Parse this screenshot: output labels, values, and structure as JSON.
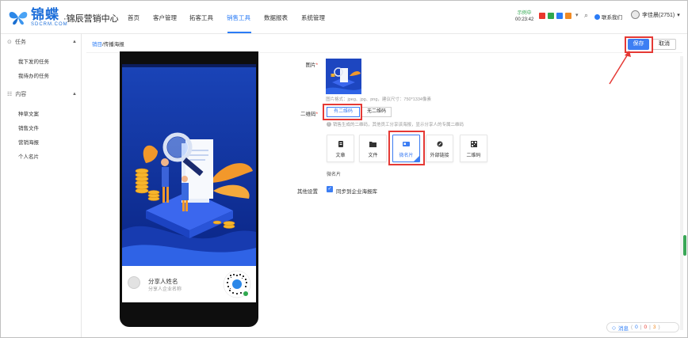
{
  "header": {
    "brand_cn": "锦蝶",
    "brand_en": "SDCRM.COM",
    "app_title": "·锦辰营销中心",
    "nav": [
      "首页",
      "客户管理",
      "拓客工具",
      "销售工具",
      "数据报表",
      "系统管理"
    ],
    "active_nav": "销售工具",
    "clock_label": "示例中",
    "clock_time": "00:23:42",
    "contact_label": "联系我们",
    "user_name": "李佳晨(2751)"
  },
  "sidebar": {
    "sections": [
      {
        "title": "任务",
        "items": [
          "我下发的任务",
          "我待办的任务"
        ]
      },
      {
        "title": "内容",
        "items": [
          "种草文案",
          "销售文件",
          "营销海报",
          "个人名片"
        ]
      }
    ]
  },
  "breadcrumb": {
    "link": "销目",
    "current": "/传播海报"
  },
  "actions": {
    "save": "保存",
    "cancel": "取消"
  },
  "phone_preview": {
    "sharer_name": "分享人姓名",
    "sharer_company": "分享人企业名称"
  },
  "form": {
    "image_label": "图片",
    "image_hint": "图片格式：jpeg、jpg、png，建议尺寸：750*1334像素",
    "qr_label": "二维码",
    "qr_options": [
      "有二维码",
      "无二维码"
    ],
    "qr_selected": "有二维码",
    "qr_hint": "销售生成的二维码，其他员工分享该海报，显示分享人的专属二维码",
    "types": [
      {
        "label": "文章",
        "icon": "article-icon"
      },
      {
        "label": "文件",
        "icon": "folder-icon"
      },
      {
        "label": "微名片",
        "icon": "card-icon"
      },
      {
        "label": "外部链接",
        "icon": "link-icon"
      },
      {
        "label": "二维码",
        "icon": "qrcode-icon"
      }
    ],
    "selected_type": "微名片",
    "selected_text": "微名片",
    "other_label": "其他设置",
    "sync_label": "同步到企业海报库",
    "sync_checked": true
  },
  "footer_chip": {
    "label": "消息",
    "counts": [
      "0",
      "0",
      "3"
    ]
  },
  "colors": {
    "accent": "#3d7ef3",
    "brand": "#1e6fd9",
    "highlight": "#e53935"
  }
}
